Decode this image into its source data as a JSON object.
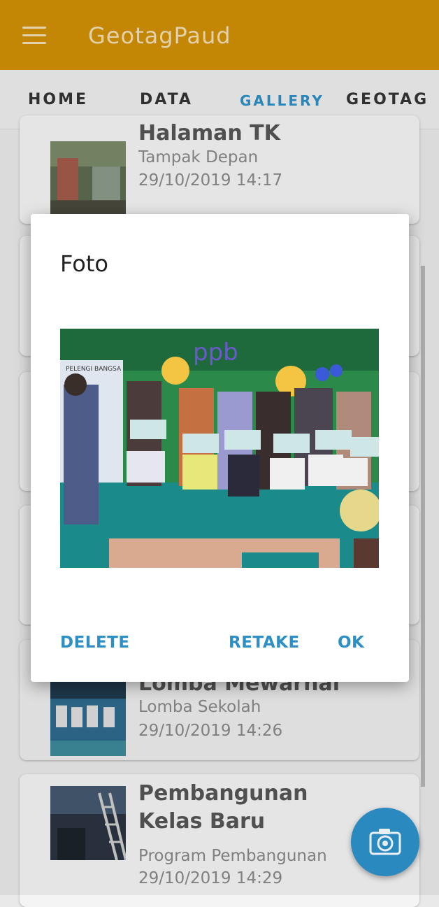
{
  "app": {
    "title": "GeotagPaud"
  },
  "tabs": [
    {
      "label": "HOME"
    },
    {
      "label": "DATA"
    },
    {
      "label": "GALLERY",
      "active": true
    },
    {
      "label": "GEOTAG"
    }
  ],
  "gallery": {
    "items": [
      {
        "title": "Halaman TK",
        "subtitle": "Tampak Depan",
        "date": "29/10/2019 14:17"
      },
      {
        "title": "Lomba Mewarnai",
        "subtitle": "Lomba Sekolah",
        "date": "29/10/2019 14:26"
      },
      {
        "title": "Pembangunan Kelas Baru",
        "subtitle": "Program Pembangunan",
        "date": "29/10/2019 14:29"
      }
    ]
  },
  "dialog": {
    "title": "Foto",
    "buttons": {
      "delete": "DELETE",
      "retake": "RETAKE",
      "ok": "OK"
    },
    "photo_banner": "PELENGI BANGSA",
    "photo_letters": "ppb"
  },
  "fab": {
    "icon": "camera-icon"
  },
  "colors": {
    "appbar": "#d18f06",
    "accent": "#2d8fc4"
  }
}
